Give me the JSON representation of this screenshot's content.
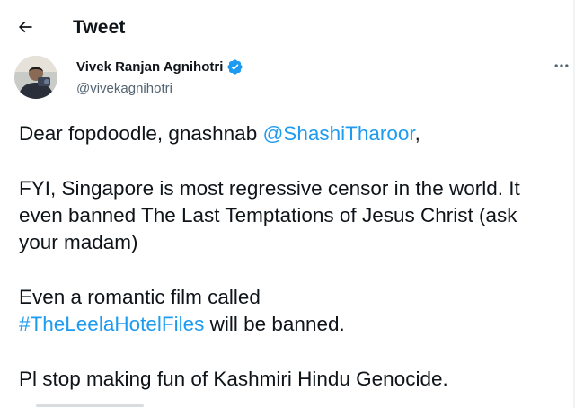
{
  "header": {
    "back_icon": "arrow-left-icon",
    "title": "Tweet"
  },
  "tweet": {
    "author": {
      "name": "Vivek Ranjan Agnihotri",
      "handle": "@vivekagnihotri",
      "verified_icon": "verified-badge-icon",
      "verified_color": "#1d9bf0"
    },
    "more_icon": "more-options-icon",
    "link_color": "#1d9bf0",
    "paragraphs": {
      "p1_text": "Dear fopdoodle, gnashnab ",
      "p1_mention": "@ShashiTharoor",
      "p1_end": ",",
      "p2_line1": "FYI, Singapore is most regressive censor in the world. It",
      "p2_line2": "even banned The Last Temptations of Jesus Christ (ask",
      "p2_line3": "your madam)",
      "p3_line1": "Even a romantic film called",
      "p3_hashtag": "#TheLeelaHotelFiles",
      "p3_end": " will be banned.",
      "p4_line1": "Pl stop making fun of Kashmiri Hindu Genocide."
    }
  }
}
